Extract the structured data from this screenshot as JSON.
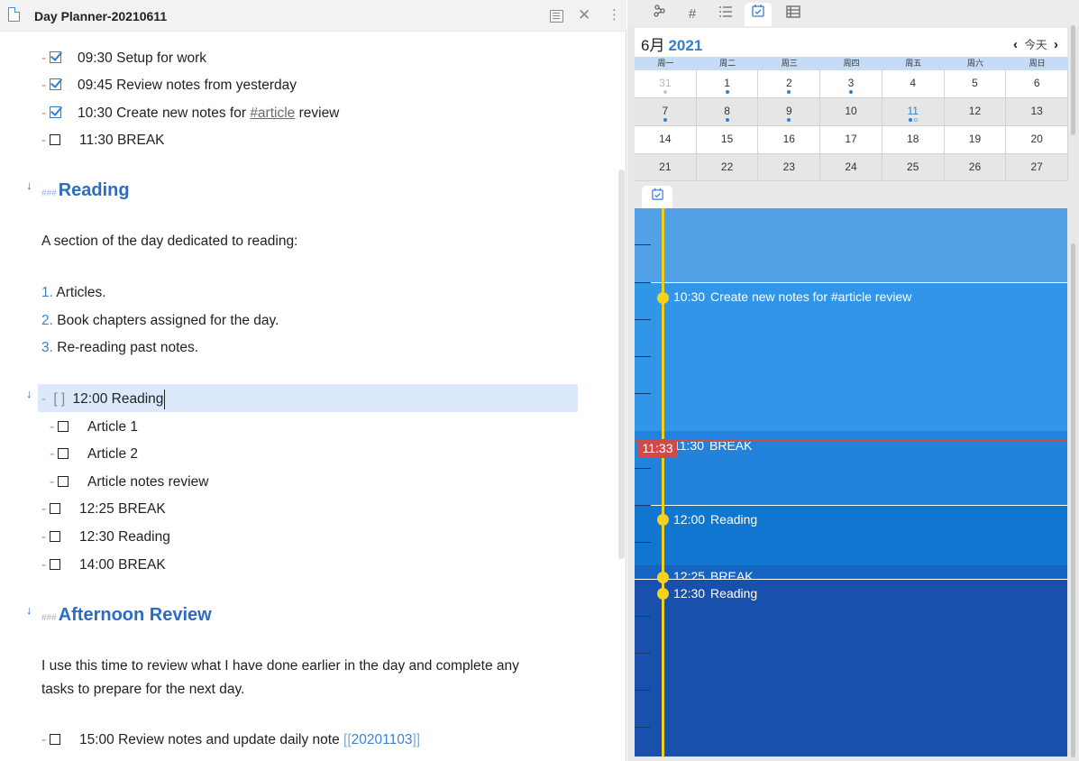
{
  "editor": {
    "title": "Day Planner-20210611",
    "tasks_top": [
      {
        "time": "09:30",
        "text": "Setup for work",
        "checked": true
      },
      {
        "time": "09:45",
        "text": "Review notes from yesterday",
        "checked": true
      },
      {
        "time": "10:30",
        "text": "Create new notes for ",
        "tag": "#article",
        "after": " review",
        "checked": true
      },
      {
        "time": "11:30",
        "text": "BREAK",
        "checked": false
      }
    ],
    "heading_reading": "Reading",
    "heading_hashes": "###",
    "reading_intro": "A section of the day dedicated to reading:",
    "reading_list": [
      {
        "num": "1.",
        "text": "Articles."
      },
      {
        "num": "2.",
        "text": "Book chapters assigned for the day."
      },
      {
        "num": "3.",
        "text": "Re-reading past notes."
      }
    ],
    "reading_task": {
      "checkbox": "[ ]",
      "time": "12:00",
      "text": "Reading"
    },
    "reading_subtasks": [
      "Article 1",
      "Article 2",
      "Article notes review"
    ],
    "tasks_mid": [
      {
        "time": "12:25",
        "text": "BREAK"
      },
      {
        "time": "12:30",
        "text": "Reading"
      },
      {
        "time": "14:00",
        "text": "BREAK"
      }
    ],
    "heading_afternoon": "Afternoon Review",
    "afternoon_para_1": "I use this time to review what I have done earlier in the day and complete any",
    "afternoon_para_2": "tasks to prepare for the next day.",
    "last_task": {
      "time": "15:00",
      "text": "Review notes and update daily note ",
      "link_open": "[[",
      "link": "20201103",
      "link_close": "]]"
    }
  },
  "right_tabs": [
    "graph-icon",
    "tag-icon",
    "outline-icon",
    "calendar-check-icon",
    "table-icon"
  ],
  "calendar": {
    "month": "6月",
    "year": "2021",
    "today_label": "今天",
    "weekdays": [
      "周一",
      "周二",
      "周三",
      "周四",
      "周五",
      "周六",
      "周日"
    ],
    "weeks": [
      [
        "31",
        "1",
        "2",
        "3",
        "4",
        "5",
        "6"
      ],
      [
        "7",
        "8",
        "9",
        "10",
        "11",
        "12",
        "13"
      ],
      [
        "14",
        "15",
        "16",
        "17",
        "18",
        "19",
        "20"
      ],
      [
        "21",
        "22",
        "23",
        "24",
        "25",
        "26",
        "27"
      ]
    ]
  },
  "timeline": {
    "now": "11:33",
    "events": [
      {
        "time": "10:30",
        "text": "Create new notes for #article review"
      },
      {
        "time": "11:30",
        "text": "BREAK"
      },
      {
        "time": "12:00",
        "text": "Reading"
      },
      {
        "time": "12:25",
        "text": "BREAK"
      },
      {
        "time": "12:30",
        "text": "Reading"
      }
    ]
  },
  "colors": {
    "accent": "#2f7fd4",
    "timeline_now": "#d14a4a",
    "timeline_dot": "#f7d11a"
  }
}
